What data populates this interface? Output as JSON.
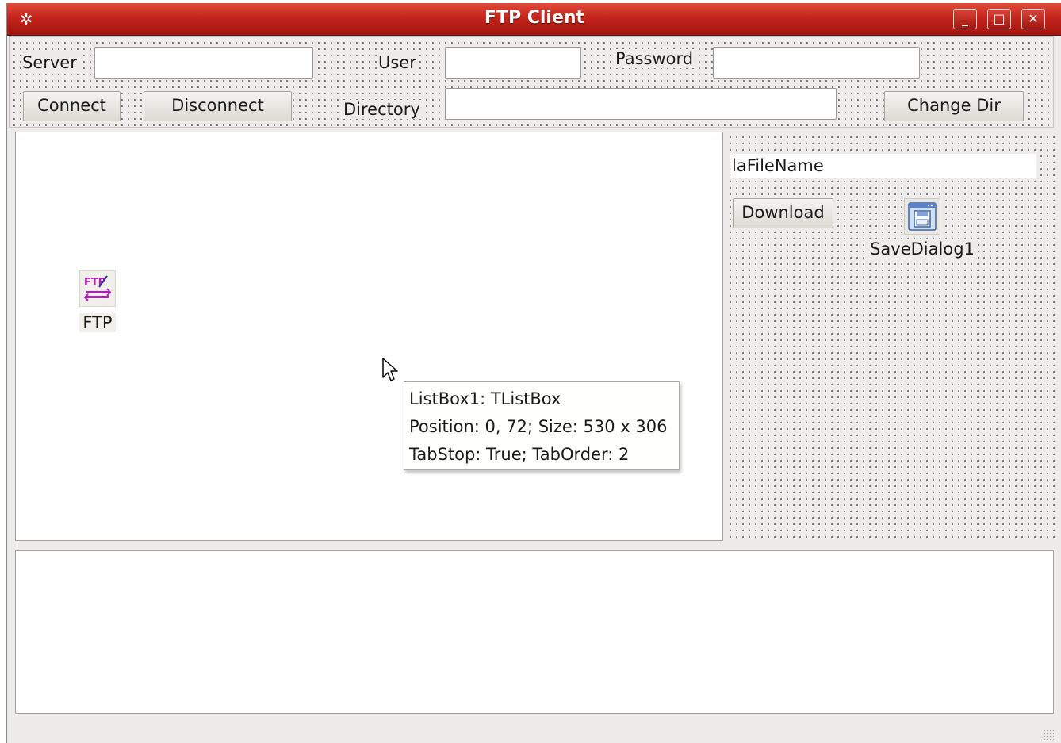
{
  "window": {
    "title": "FTP Client",
    "controls": {
      "minimize": "_",
      "maximize": "□",
      "close": "✕"
    }
  },
  "toolbar": {
    "server_label": "Server",
    "server_value": "",
    "user_label": "User",
    "user_value": "",
    "password_label": "Password",
    "password_value": "",
    "connect_label": "Connect",
    "disconnect_label": "Disconnect",
    "directory_label": "Directory",
    "directory_value": "",
    "change_dir_label": "Change Dir"
  },
  "side": {
    "filename_label": "laFileName",
    "download_label": "Download",
    "save_dialog_label": "SaveDialog1"
  },
  "components": {
    "ftp_label": "FTP"
  },
  "tooltip": {
    "line1": "ListBox1: TListBox",
    "line2": "Position: 0, 72; Size: 530 x 306",
    "line3": "TabStop: True; TabOrder: 2"
  },
  "colors": {
    "titlebar": "#c4241b",
    "form_bg": "#edeceb"
  },
  "icons": {
    "app": "gear-icon",
    "ftp": "ftp-component-icon",
    "save_dialog": "floppy-disk-icon",
    "cursor": "mouse-pointer-icon"
  }
}
